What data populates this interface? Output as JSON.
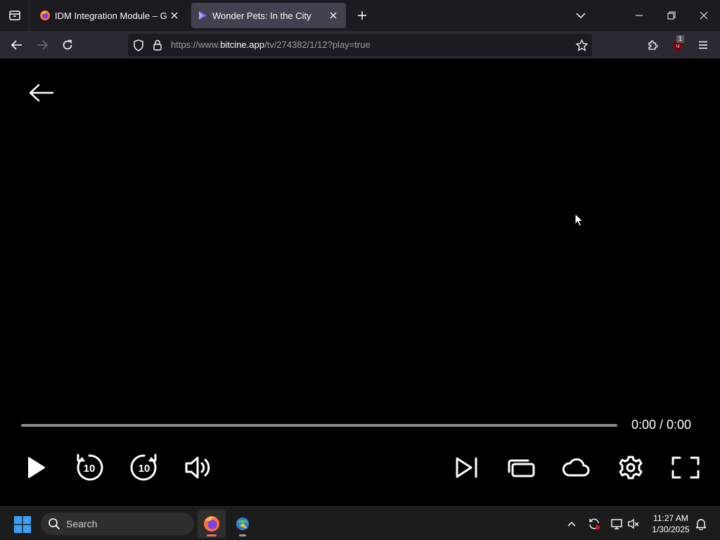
{
  "browser": {
    "tabs": [
      {
        "title": "IDM Integration Module – Get t",
        "active": false
      },
      {
        "title": "Wonder Pets: In the City",
        "active": true
      }
    ],
    "url_scheme": "https://www.",
    "url_host": "bitcine.app",
    "url_path": "/tv/274382/1/12?play=true",
    "extension_badge": "1"
  },
  "player": {
    "time_display": "0:00 / 0:00",
    "progress": 0,
    "controls": [
      "play",
      "rewind-10",
      "forward-10",
      "volume",
      "next-episode",
      "episodes",
      "cloud",
      "settings",
      "fullscreen"
    ],
    "skip_label_back": "10",
    "skip_label_forward": "10"
  },
  "taskbar": {
    "search_placeholder": "Search",
    "apps": [
      "firefox",
      "internet-download-manager"
    ],
    "time": "11:27 AM",
    "date": "1/30/2025"
  },
  "colors": {
    "tabstrip_bg": "#1c1b22",
    "active_tab_bg": "#42414d",
    "navbar_bg": "#2b2a33",
    "player_bg": "#000000",
    "progress_track": "#8a8a8a",
    "taskbar_bg": "#1c1c1c",
    "windows_blue": "#3aa0f5",
    "firefox_indicator": "#e0706a"
  }
}
